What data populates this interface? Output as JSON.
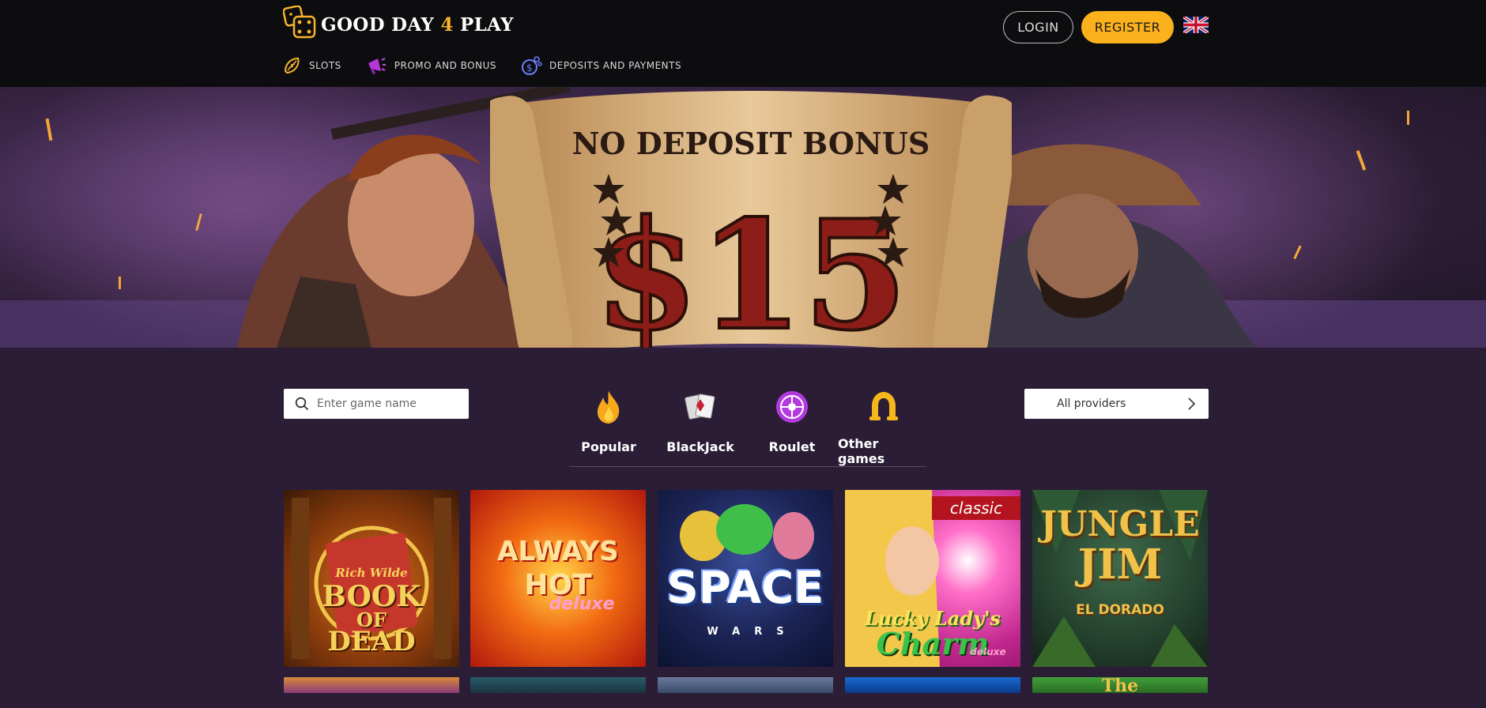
{
  "brand": {
    "logo_part1": "GOOD DAY ",
    "logo_part2": "4",
    "logo_part3": " PLAY",
    "accent": "#fbb11c"
  },
  "header": {
    "login_label": "LOGIN",
    "register_label": "REGISTER",
    "language_icon": "uk-flag-icon"
  },
  "nav": {
    "items": [
      {
        "label": "SLOTS",
        "icon": "lemon-icon"
      },
      {
        "label": "PROMO AND BONUS",
        "icon": "megaphone-icon"
      },
      {
        "label": "DEPOSITS AND PAYMENTS",
        "icon": "coins-icon"
      }
    ]
  },
  "banner": {
    "headline": "NO DEPOSIT BONUS",
    "amount": "$15"
  },
  "filters": {
    "search_placeholder": "Enter game name",
    "categories": [
      {
        "label": "Popular",
        "icon": "fire-icon"
      },
      {
        "label": "BlackJack",
        "icon": "cards-icon"
      },
      {
        "label": "Roulet",
        "icon": "roulette-icon"
      },
      {
        "label": "Other games",
        "icon": "horseshoe-icon"
      }
    ],
    "providers_label": "All providers"
  },
  "games": [
    {
      "title": "Book of Dead",
      "line1": "Rich Wilde",
      "line2": "BOOK",
      "line3": "OF",
      "line4": "DEAD"
    },
    {
      "title": "Always Hot deluxe",
      "line1": "ALWAYS",
      "line2": "HOT",
      "line3": "deluxe"
    },
    {
      "title": "Space Wars",
      "line1": "SPACE",
      "line2": "WARS"
    },
    {
      "title": "Lucky Lady's Charm deluxe",
      "badge": "classic",
      "line1": "Lucky Lady's",
      "line2": "Charm",
      "line3": "deluxe"
    },
    {
      "title": "Jungle Jim El Dorado",
      "line1": "JUNGLE",
      "line2": "JIM",
      "line3": "EL DORADO"
    }
  ],
  "games_row2_partial": [
    {
      "title": ""
    },
    {
      "title": ""
    },
    {
      "title": ""
    },
    {
      "title": ""
    },
    {
      "title": "The"
    }
  ]
}
